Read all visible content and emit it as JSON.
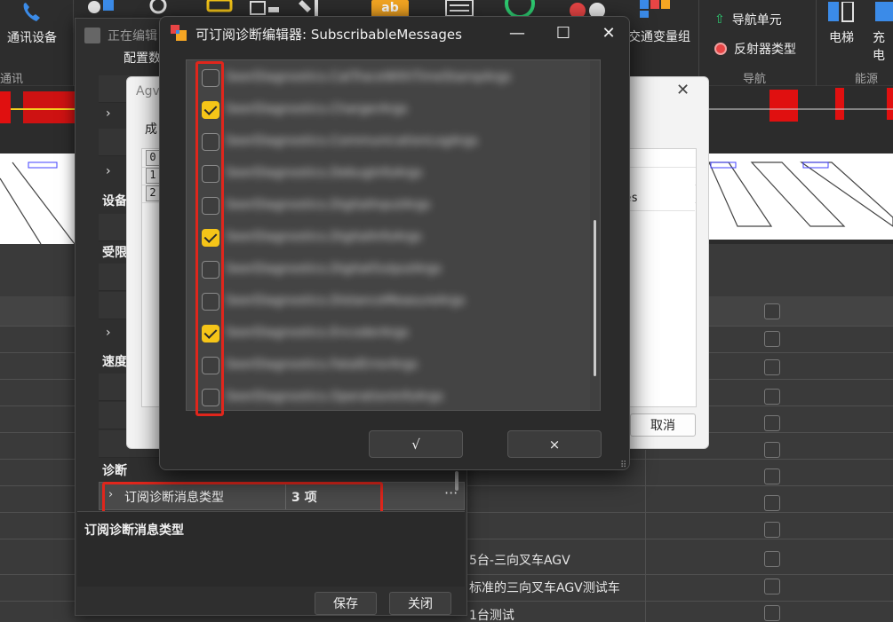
{
  "ribbon": {
    "comm_device": "通讯设备",
    "comm_group": "通讯",
    "editing_label": "正在编辑",
    "ab_icon": "ab",
    "variable_group": "交通变量组",
    "nav_unit": "导航单元",
    "reflector_type": "反射器类型",
    "nav_group": "导航",
    "elevator": "电梯",
    "charger": "充电",
    "energy_group": "能源"
  },
  "property_panel": {
    "cat_top": "配置数",
    "cat_device": "设备",
    "cat_limit": "受限",
    "cat_speed": "速度",
    "cat_diag": "诊断",
    "selected_row": {
      "name": "订阅诊断消息类型",
      "value": "3 项",
      "more": "···"
    },
    "desc_title": "订阅诊断消息类型",
    "save": "保存",
    "close": "关闭"
  },
  "mid_dialog": {
    "title": "Agv",
    "label_prefix": "成",
    "row_indexes": [
      "0",
      "1",
      "2"
    ],
    "partial_text": "sages",
    "cancel": "取消"
  },
  "background_rows": [
    {
      "text": "5台-三向叉车AGV"
    },
    {
      "text": "标准的三向叉车AGV测试车"
    },
    {
      "text": "1台测试"
    }
  ],
  "dialog": {
    "title": "可订阅诊断编辑器: SubscribableMessages",
    "items": [
      {
        "label": "SeerDiagnostics.CatTraceWithTimeStampArgs",
        "checked": false
      },
      {
        "label": "SeerDiagnostics.ChargerArgs",
        "checked": true
      },
      {
        "label": "SeerDiagnostics.CommunicationLogArgs",
        "checked": false
      },
      {
        "label": "SeerDiagnostics.DebugInfoArgs",
        "checked": false
      },
      {
        "label": "SeerDiagnostics.DigitalInputArgs",
        "checked": false
      },
      {
        "label": "SeerDiagnostics.DigitalInfoArgs",
        "checked": true
      },
      {
        "label": "SeerDiagnostics.DigitalOutputArgs",
        "checked": false
      },
      {
        "label": "SeerDiagnostics.DistanceMeasureArgs",
        "checked": false
      },
      {
        "label": "SeerDiagnostics.EncoderArgs",
        "checked": true
      },
      {
        "label": "SeerDiagnostics.FatalErrorArgs",
        "checked": false
      },
      {
        "label": "SeerDiagnostics.OperationInfoArgs",
        "checked": false
      }
    ],
    "ok": "√",
    "cancel": "×",
    "minimize": "—",
    "maximize": "☐",
    "close": "✕"
  },
  "colors": {
    "accent_check": "#f5c518",
    "highlight_red": "#e0261c"
  }
}
